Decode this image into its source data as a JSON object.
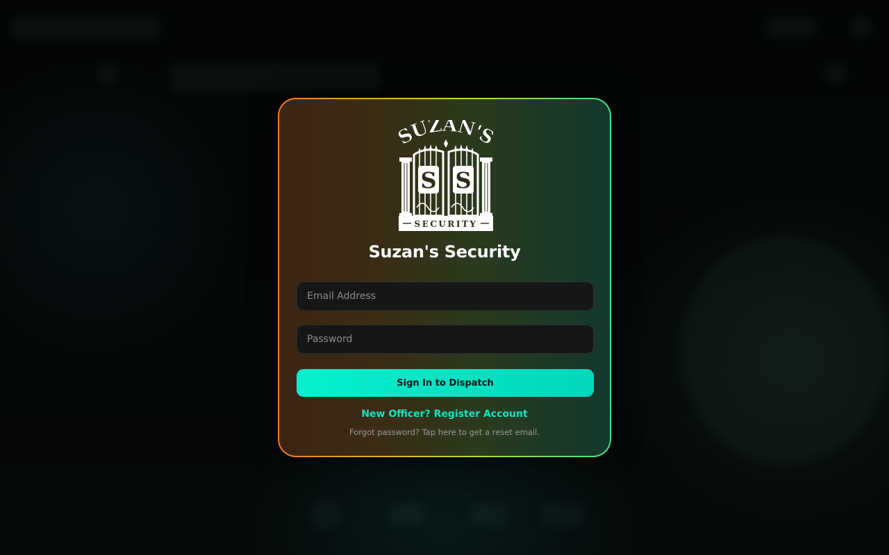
{
  "brand": {
    "name": "Suzan's Security",
    "logo_text_top": "SUZAN'S",
    "logo_text_bottom": "SECURITY",
    "logo_monogram": "S"
  },
  "login": {
    "email_placeholder": "Email Address",
    "password_placeholder": "Password",
    "submit_label": "Sign In to Dispatch",
    "register_link": "New Officer? Register Account",
    "forgot_link": "Forgot password? Tap here to get a reset email."
  },
  "colors": {
    "accent": "#08f0cf",
    "link": "#17e3c3",
    "border_start": "#f07a22",
    "border_end": "#3fe38a"
  },
  "icons": {
    "logo": "gate-logo-icon"
  }
}
